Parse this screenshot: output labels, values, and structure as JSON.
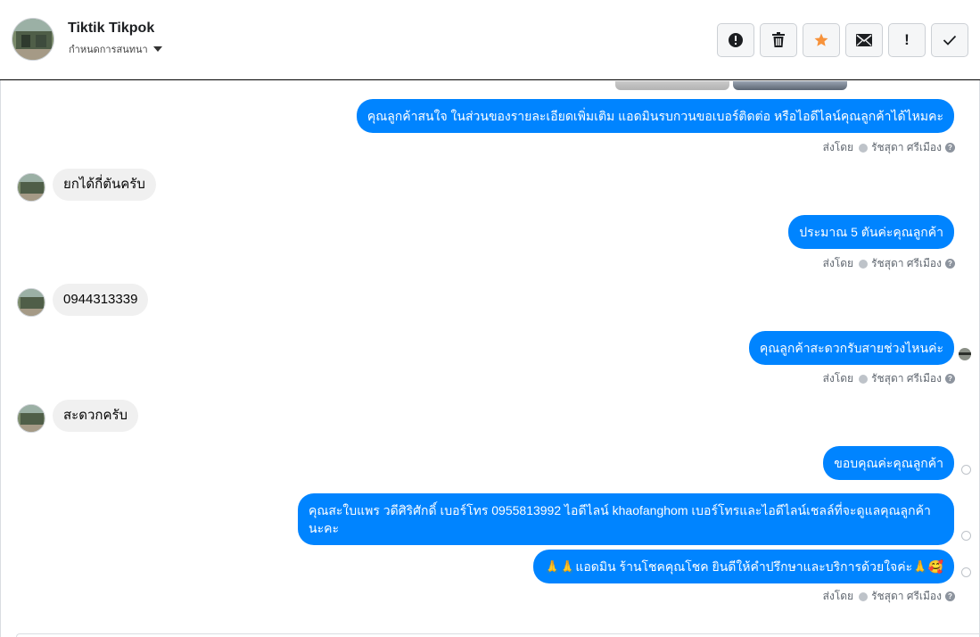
{
  "header": {
    "contact_name": "Tiktik Tikpok",
    "assign_label": "กำหนดการสนทนา",
    "actions": [
      {
        "icon": "alert-circle-icon"
      },
      {
        "icon": "trash-icon"
      },
      {
        "icon": "star-icon"
      },
      {
        "icon": "envelope-icon"
      },
      {
        "icon": "exclamation-icon",
        "label": "!"
      },
      {
        "icon": "checkmark-icon"
      }
    ]
  },
  "colors": {
    "outgoing_bubble": "#0084ff",
    "incoming_bubble": "#f0f0f0",
    "star": "#f7923a"
  },
  "messages": [
    {
      "direction": "out",
      "text": "คุณลูกค้าสนใจ ในส่วนของรายละเอียดเพิ่มเติม แอดมินรบกวนขอเบอร์ติดต่อ หรือไอดีไลน์คุณลูกค้าได้ไหมคะ"
    },
    {
      "direction": "in",
      "text": "ยกได้กี่ตันครับ"
    },
    {
      "direction": "out",
      "text": "ประมาณ  5  ตันค่ะคุณลูกค้า"
    },
    {
      "direction": "in",
      "text": "0944313339"
    },
    {
      "direction": "out",
      "text": "คุณลูกค้าสะดวกรับสายช่วงไหนค่ะ"
    },
    {
      "direction": "in",
      "text": "สะดวกครับ"
    },
    {
      "direction": "out",
      "text": "ขอบคุณค่ะคุณลูกค้า"
    },
    {
      "direction": "out",
      "text": "คุณสะใบแพร วดีศิริศักดิ์ เบอร์โทร 0955813992  ไอดีไลน์  khaofanghom  เบอร์โทรและไอดีไลน์เชลล์ที่จะดูแลคุณลูกค้านะคะ"
    },
    {
      "direction": "out",
      "text": "🙏🙏แอดมิน ร้านโชคคุณโชค ยินดีให้คำปรึกษาและบริการด้วยใจค่ะ🙏🥰"
    }
  ],
  "sent_by": {
    "label": "ส่งโดย",
    "agent": "รัชสุดา ศรีเมือง",
    "help": "?"
  }
}
